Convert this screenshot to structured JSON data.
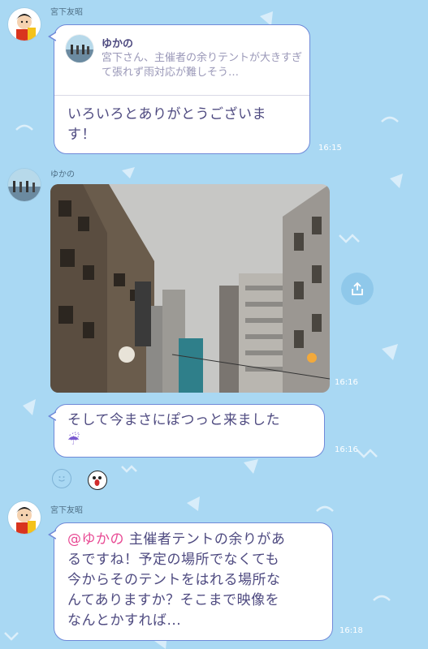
{
  "messages": [
    {
      "sender": "宮下友昭",
      "reply": {
        "name": "ゆかの",
        "text": "宮下さん、主催者の余りテントが大きすぎて張れず雨対応が難しそう…"
      },
      "text_line1": "いろいろとありがとうございま",
      "text_line2": "す！",
      "time": "16:15"
    },
    {
      "sender": "ゆかの",
      "time": "16:16",
      "photo_desc": "building-photo"
    },
    {
      "text_line1": "そして今まさにぽつっと来ました",
      "emoji": "☔",
      "time": "16:16"
    },
    {
      "sender": "宮下友昭",
      "mention": "@ゆかの",
      "text_line1": " 主催者テントの余りがあ",
      "text_line2": "るですね！予定の場所でなくても",
      "text_line3": "今からそのテントをはれる場所な",
      "text_line4": "んてありますか？そこまで映像を",
      "text_line5": "なんとかすれば...",
      "time": "16:18"
    }
  ],
  "colors": {
    "background": "#a9d8f3",
    "bubble_border": "#6f89d8",
    "text": "#4e4a80",
    "mention": "#e84a94"
  },
  "icons": {
    "share": "share-icon",
    "reaction": "smile-icon"
  }
}
